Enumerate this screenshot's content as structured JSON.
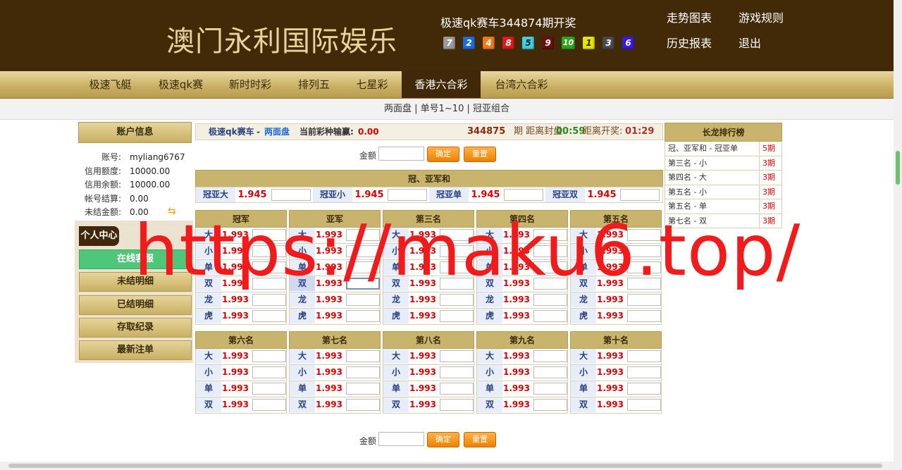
{
  "header": {
    "logo": "澳门永利国际娱乐",
    "draw_title": "极速qk赛车344874期开奖",
    "balls": [
      {
        "num": "7",
        "color": "#9a9a9a"
      },
      {
        "num": "2",
        "color": "#1a6fe0"
      },
      {
        "num": "4",
        "color": "#ef7a1a"
      },
      {
        "num": "8",
        "color": "#e01a1a"
      },
      {
        "num": "5",
        "color": "#3fd0e6"
      },
      {
        "num": "9",
        "color": "#6b0f0f"
      },
      {
        "num": "10",
        "color": "#2aa81a"
      },
      {
        "num": "1",
        "color": "#e6e600"
      },
      {
        "num": "3",
        "color": "#4a4a4a"
      },
      {
        "num": "6",
        "color": "#3a1ae0"
      }
    ],
    "links": [
      "走势图表",
      "游戏规则",
      "历史报表",
      "退出"
    ]
  },
  "nav": {
    "tabs": [
      "极速飞艇",
      "极速qk赛",
      "新时时彩",
      "排列五",
      "七星彩",
      "香港六合彩",
      "台湾六合彩"
    ],
    "active_index": 5
  },
  "subnav": "两面盘 | 单号1~10 | 冠亚组合",
  "sidebar": {
    "account_title": "账户信息",
    "rows": [
      {
        "label": "账号:",
        "value": "myliang6767"
      },
      {
        "label": "信用额度:",
        "value": "10000.00"
      },
      {
        "label": "信用余额:",
        "value": "10000.00"
      },
      {
        "label": "帐号结算:",
        "value": "0.00"
      },
      {
        "label": "未结金额:",
        "value": "0.00"
      }
    ],
    "personal_tag": "个人中心",
    "buttons": [
      "在线客服",
      "未结明细",
      "已结明细",
      "存取纪录",
      "最新注单"
    ]
  },
  "info_bar": {
    "game": "极速qk赛车",
    "sep": "-",
    "mode": "两面盘",
    "profit_label": "当前彩种输赢:",
    "profit_value": "0.00",
    "issue": "344875",
    "close_label": "期  距离封盘:",
    "close_time": "00:59",
    "open_label": "距离开奖:",
    "open_time": "01:29"
  },
  "amount": {
    "label": "金额",
    "confirm": "确定",
    "reset": "重置"
  },
  "combo": {
    "title": "冠、亚军和",
    "items": [
      {
        "label": "冠亚大",
        "odds": "1.945"
      },
      {
        "label": "冠亚小",
        "odds": "1.945"
      },
      {
        "label": "冠亚单",
        "odds": "1.945"
      },
      {
        "label": "冠亚双",
        "odds": "1.945"
      }
    ]
  },
  "top_grid": [
    {
      "title": "冠军",
      "rows": [
        {
          "label": "大",
          "odds": "1.993"
        },
        {
          "label": "小",
          "odds": "1.993"
        },
        {
          "label": "单",
          "odds": "1.993"
        },
        {
          "label": "双",
          "odds": "1.993"
        },
        {
          "label": "龙",
          "odds": "1.993"
        },
        {
          "label": "虎",
          "odds": "1.993"
        }
      ]
    },
    {
      "title": "亚军",
      "rows": [
        {
          "label": "大",
          "odds": "1.993"
        },
        {
          "label": "小",
          "odds": "1.993"
        },
        {
          "label": "单",
          "odds": "1.993"
        },
        {
          "label": "双",
          "odds": "1.993"
        },
        {
          "label": "龙",
          "odds": "1.993"
        },
        {
          "label": "虎",
          "odds": "1.993"
        }
      ]
    },
    {
      "title": "第三名",
      "rows": [
        {
          "label": "大",
          "odds": "1.993"
        },
        {
          "label": "小",
          "odds": "1.993"
        },
        {
          "label": "单",
          "odds": "1.993"
        },
        {
          "label": "双",
          "odds": "1.993"
        },
        {
          "label": "龙",
          "odds": "1.993"
        },
        {
          "label": "虎",
          "odds": "1.993"
        }
      ]
    },
    {
      "title": "第四名",
      "rows": [
        {
          "label": "大",
          "odds": "1.993"
        },
        {
          "label": "小",
          "odds": "1.993"
        },
        {
          "label": "单",
          "odds": "1.993"
        },
        {
          "label": "双",
          "odds": "1.993"
        },
        {
          "label": "龙",
          "odds": "1.993"
        },
        {
          "label": "虎",
          "odds": "1.993"
        }
      ]
    },
    {
      "title": "第五名",
      "rows": [
        {
          "label": "大",
          "odds": "1.993"
        },
        {
          "label": "小",
          "odds": "1.993"
        },
        {
          "label": "单",
          "odds": "1.993"
        },
        {
          "label": "双",
          "odds": "1.993"
        },
        {
          "label": "龙",
          "odds": "1.993"
        },
        {
          "label": "虎",
          "odds": "1.993"
        }
      ]
    }
  ],
  "bottom_grid": [
    {
      "title": "第六名",
      "rows": [
        {
          "label": "大",
          "odds": "1.993"
        },
        {
          "label": "小",
          "odds": "1.993"
        },
        {
          "label": "单",
          "odds": "1.993"
        },
        {
          "label": "双",
          "odds": "1.993"
        }
      ]
    },
    {
      "title": "第七名",
      "rows": [
        {
          "label": "大",
          "odds": "1.993"
        },
        {
          "label": "小",
          "odds": "1.993"
        },
        {
          "label": "单",
          "odds": "1.993"
        },
        {
          "label": "双",
          "odds": "1.993"
        }
      ]
    },
    {
      "title": "第八名",
      "rows": [
        {
          "label": "大",
          "odds": "1.993"
        },
        {
          "label": "小",
          "odds": "1.993"
        },
        {
          "label": "单",
          "odds": "1.993"
        },
        {
          "label": "双",
          "odds": "1.993"
        }
      ]
    },
    {
      "title": "第九名",
      "rows": [
        {
          "label": "大",
          "odds": "1.993"
        },
        {
          "label": "小",
          "odds": "1.993"
        },
        {
          "label": "单",
          "odds": "1.993"
        },
        {
          "label": "双",
          "odds": "1.993"
        }
      ]
    },
    {
      "title": "第十名",
      "rows": [
        {
          "label": "大",
          "odds": "1.993"
        },
        {
          "label": "小",
          "odds": "1.993"
        },
        {
          "label": "单",
          "odds": "1.993"
        },
        {
          "label": "双",
          "odds": "1.993"
        }
      ]
    }
  ],
  "long_dragon": {
    "title": "长龙排行榜",
    "rows": [
      {
        "name": "冠、亚军和 - 冠亚单",
        "count": "5期"
      },
      {
        "name": "第三名 - 小",
        "count": "3期"
      },
      {
        "name": "第四名 - 大",
        "count": "3期"
      },
      {
        "name": "第五名 - 小",
        "count": "3期"
      },
      {
        "name": "第五名 - 单",
        "count": "3期"
      },
      {
        "name": "第七名 - 双",
        "count": "3期"
      }
    ]
  },
  "watermark": "https://maku6.top/"
}
